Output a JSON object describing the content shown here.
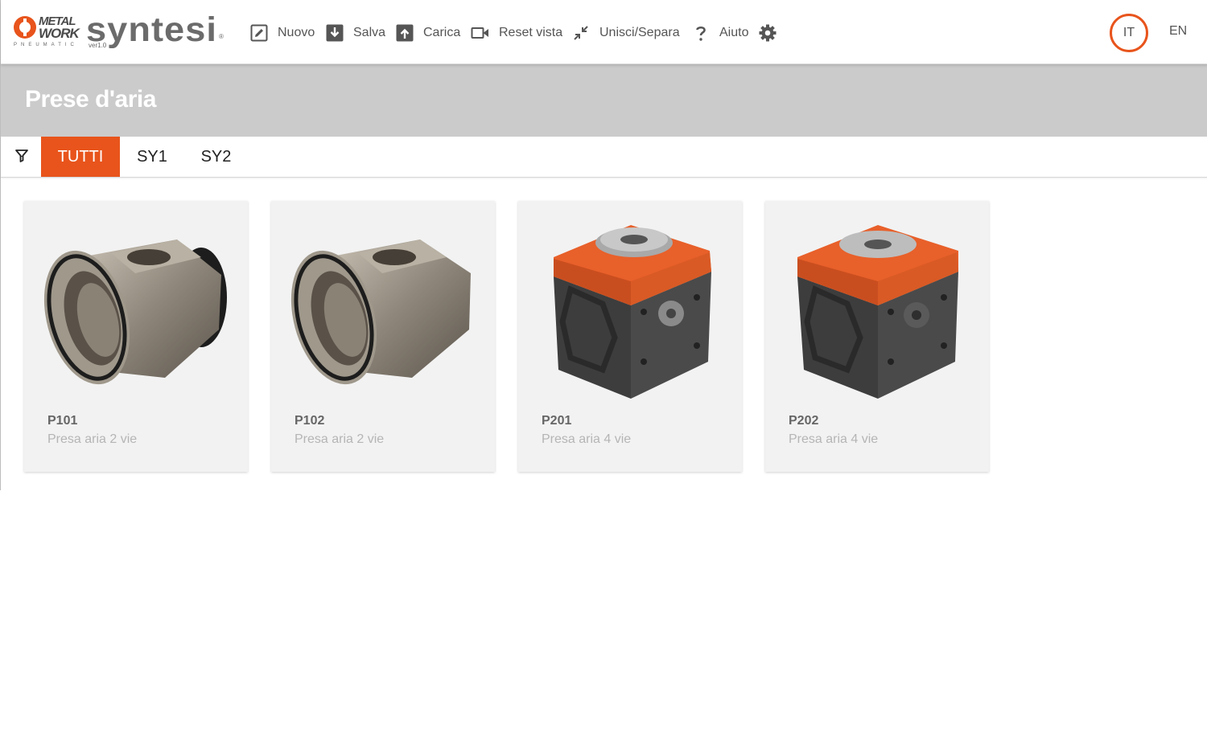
{
  "brand": {
    "metalwork_line1": "METAL",
    "metalwork_line2": "WORK",
    "metalwork_sub": "PNEUMATIC",
    "app_name": "syntesi",
    "version": "ver1.0",
    "registered": "®",
    "accent_color": "#e8541c"
  },
  "toolbar": [
    {
      "label": "Nuovo",
      "icon": "edit-icon"
    },
    {
      "label": "Salva",
      "icon": "download-icon"
    },
    {
      "label": "Carica",
      "icon": "upload-icon"
    },
    {
      "label": "Reset vista",
      "icon": "video-camera-icon"
    },
    {
      "label": "Unisci/Separa",
      "icon": "collapse-arrows-icon"
    },
    {
      "label": "Aiuto",
      "icon": "question-icon"
    },
    {
      "label": "",
      "icon": "gear-icon"
    }
  ],
  "languages": {
    "active": "IT",
    "other": "EN"
  },
  "page": {
    "title": "Prese d'aria"
  },
  "filter": {
    "icon": "filter-icon",
    "tabs": [
      "TUTTI",
      "SY1",
      "SY2"
    ],
    "active": "TUTTI"
  },
  "products": [
    {
      "code": "P101",
      "description": "Presa aria 2 vie",
      "image": "brass-fitting-2-way"
    },
    {
      "code": "P102",
      "description": "Presa aria 2 vie",
      "image": "brass-fitting-2-way"
    },
    {
      "code": "P201",
      "description": "Presa aria 4 vie",
      "image": "orange-block-4-way"
    },
    {
      "code": "P202",
      "description": "Presa aria 4 vie",
      "image": "orange-block-4-way"
    }
  ]
}
